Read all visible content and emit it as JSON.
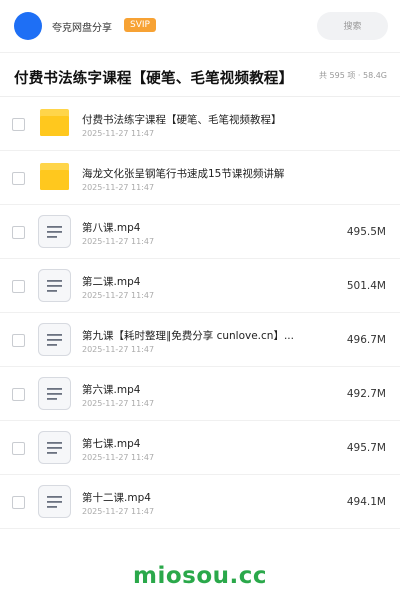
{
  "header": {
    "account_name": "夸克网盘分享",
    "badge": "SVIP",
    "search_placeholder": "搜索"
  },
  "folder": {
    "title": "付费书法练字课程【硬笔、毛笔视频教程】",
    "stats": "共 595 项 · 58.4G"
  },
  "items": [
    {
      "type": "folder",
      "name": "付费书法练字课程【硬笔、毛笔视频教程】",
      "date": "2025-11-27 11:47",
      "size": ""
    },
    {
      "type": "folder",
      "name": "海龙文化张呈钢笔行书速成15节课视频讲解",
      "date": "2025-11-27 11:47",
      "size": ""
    },
    {
      "type": "file",
      "name": "第八课.mp4",
      "date": "2025-11-27 11:47",
      "size": "495.5M"
    },
    {
      "type": "file",
      "name": "第二课.mp4",
      "date": "2025-11-27 11:47",
      "size": "501.4M"
    },
    {
      "type": "file",
      "name": "第九课【耗时整理∥免费分享 cunlove.cn】...",
      "date": "2025-11-27 11:47",
      "size": "496.7M"
    },
    {
      "type": "file",
      "name": "第六课.mp4",
      "date": "2025-11-27 11:47",
      "size": "492.7M"
    },
    {
      "type": "file",
      "name": "第七课.mp4",
      "date": "2025-11-27 11:47",
      "size": "495.7M"
    },
    {
      "type": "file",
      "name": "第十二课.mp4",
      "date": "2025-11-27 11:47",
      "size": "494.1M"
    }
  ],
  "icons": {
    "folder": "folder-icon",
    "file": "document-icon"
  },
  "colors": {
    "accent": "#1e6ff5",
    "svip": "#f7a234",
    "folder": "#ffc81e",
    "watermark": "#2aa84a"
  },
  "watermark": "miosou.cc"
}
